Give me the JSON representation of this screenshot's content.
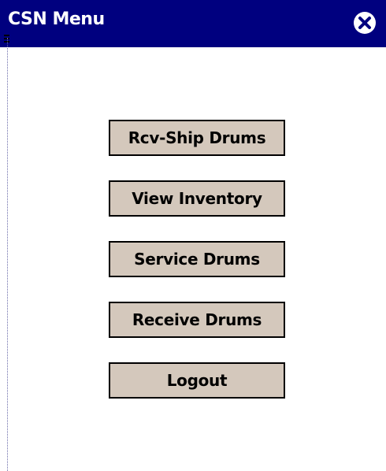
{
  "window": {
    "title": "CSN Menu",
    "close_icon": "close-circle-icon"
  },
  "menu": {
    "items": [
      {
        "label": "Rcv-Ship Drums"
      },
      {
        "label": "View Inventory"
      },
      {
        "label": "Service Drums"
      },
      {
        "label": "Receive Drums"
      },
      {
        "label": "Logout"
      }
    ]
  },
  "colors": {
    "titlebar": "#00007f",
    "button_face": "#d4c8bc",
    "background": "#ffffff"
  }
}
